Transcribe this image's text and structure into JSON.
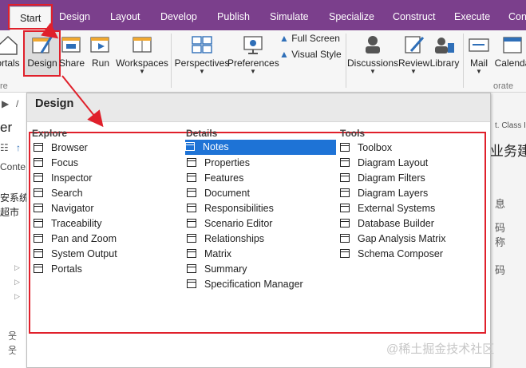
{
  "tabs": [
    {
      "label": "Start",
      "active": true
    },
    {
      "label": "Design"
    },
    {
      "label": "Layout"
    },
    {
      "label": "Develop"
    },
    {
      "label": "Publish"
    },
    {
      "label": "Simulate"
    },
    {
      "label": "Specialize"
    },
    {
      "label": "Construct"
    },
    {
      "label": "Execute"
    },
    {
      "label": "Con"
    }
  ],
  "ribbon": {
    "buttons": [
      {
        "label": "ortals",
        "icon": "portals-icon"
      },
      {
        "label": "Design",
        "icon": "design-icon"
      },
      {
        "label": "Share",
        "icon": "share-icon"
      },
      {
        "label": "Run",
        "icon": "run-icon"
      },
      {
        "label": "Workspaces",
        "icon": "workspaces-icon"
      },
      {
        "label": "Perspectives",
        "icon": "perspectives-icon"
      },
      {
        "label": "Preferences",
        "icon": "preferences-icon"
      },
      {
        "label": "Discussions",
        "icon": "discussions-icon"
      },
      {
        "label": "Review",
        "icon": "review-icon"
      },
      {
        "label": "Library",
        "icon": "library-icon"
      },
      {
        "label": "Mail",
        "icon": "mail-icon"
      },
      {
        "label": "Calenda",
        "icon": "calendar-icon"
      }
    ],
    "full_screen": "Full Screen",
    "visual_style": "Visual Style",
    "group_left": "re",
    "group_right": "orate"
  },
  "side": {
    "breadcrumb": "/",
    "title_fragment": "er",
    "context_fragment": "Conte",
    "tree_1": "安系统",
    "tree_2": "超市"
  },
  "right": {
    "class_fragment": "t.  Class I",
    "cjk_title": "业务建",
    "cjk_a": "息",
    "cjk_b": "码",
    "cjk_c": "称",
    "cjk_d": "码"
  },
  "popup": {
    "title": "Design",
    "columns": [
      {
        "heading": "Explore",
        "items": [
          "Browser",
          "Focus",
          "Inspector",
          "Search",
          "Navigator",
          "Traceability",
          "Pan and Zoom",
          "System Output",
          "Portals"
        ]
      },
      {
        "heading": "Details",
        "items": [
          "Notes",
          "Properties",
          "Features",
          "Document",
          "Responsibilities",
          "Scenario Editor",
          "Relationships",
          "Matrix",
          "Summary",
          "Specification Manager"
        ],
        "selected": "Notes"
      },
      {
        "heading": "Tools",
        "items": [
          "Toolbox",
          "Diagram Layout",
          "Diagram Filters",
          "Diagram Layers",
          "External Systems",
          "Database Builder",
          "Gap Analysis Matrix",
          "Schema Composer"
        ]
      }
    ]
  },
  "watermark": "@稀土掘金技术社区",
  "colors": {
    "tabbar": "#7b3f8c",
    "highlight": "#e0202b",
    "selection": "#1e73d6"
  }
}
